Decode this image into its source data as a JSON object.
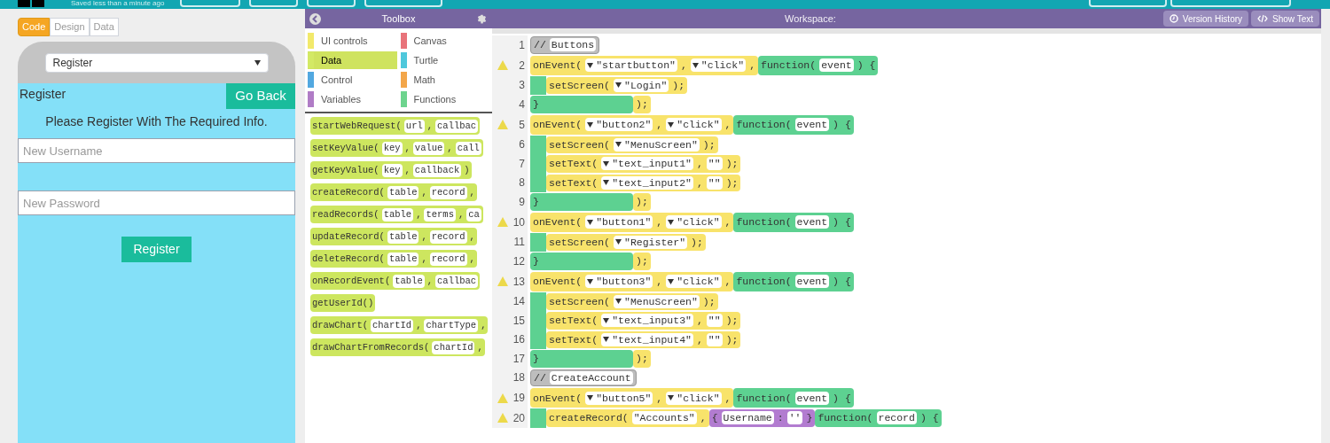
{
  "top_bar": {
    "save_status": "Saved less than a minute ago"
  },
  "mode_tabs": [
    {
      "label": "Code",
      "selected": true
    },
    {
      "label": "Design",
      "selected": false
    },
    {
      "label": "Data",
      "selected": false
    }
  ],
  "app_preview": {
    "screen_select": "Register",
    "title": "Register",
    "back_button": "Go Back",
    "heading": "Please Register With The Required Info.",
    "inputs": [
      {
        "placeholder": "New Username"
      },
      {
        "placeholder": "New Password"
      }
    ],
    "submit_button": "Register"
  },
  "toolbox": {
    "title": "Toolbox",
    "categories": [
      {
        "label": "UI controls",
        "color": "#f2e96b",
        "selected": false
      },
      {
        "label": "Canvas",
        "color": "#e8737a",
        "selected": false
      },
      {
        "label": "Data",
        "color": "#d3e965",
        "selected": true
      },
      {
        "label": "Turtle",
        "color": "#4fc8dc",
        "selected": false
      },
      {
        "label": "Control",
        "color": "#52a8e0",
        "selected": false
      },
      {
        "label": "Math",
        "color": "#f3a64a",
        "selected": false
      },
      {
        "label": "Variables",
        "color": "#b07cc6",
        "selected": false
      },
      {
        "label": "Functions",
        "color": "#6dd48e",
        "selected": false
      }
    ],
    "blocks": [
      [
        {
          "kind": "text",
          "text": "startWebRequest("
        },
        {
          "kind": "slot",
          "text": "url"
        },
        {
          "kind": "text",
          "text": ","
        },
        {
          "kind": "slot",
          "text": "callbac"
        }
      ],
      [
        {
          "kind": "text",
          "text": "setKeyValue("
        },
        {
          "kind": "slot",
          "text": "key"
        },
        {
          "kind": "text",
          "text": ","
        },
        {
          "kind": "slot",
          "text": "value"
        },
        {
          "kind": "text",
          "text": ","
        },
        {
          "kind": "slot",
          "text": "call"
        }
      ],
      [
        {
          "kind": "text",
          "text": "getKeyValue("
        },
        {
          "kind": "slot",
          "text": "key"
        },
        {
          "kind": "text",
          "text": ","
        },
        {
          "kind": "slot",
          "text": "callback"
        },
        {
          "kind": "text",
          "text": ")"
        }
      ],
      [
        {
          "kind": "text",
          "text": "createRecord("
        },
        {
          "kind": "slot",
          "text": "table"
        },
        {
          "kind": "text",
          "text": ","
        },
        {
          "kind": "slot",
          "text": "record"
        },
        {
          "kind": "text",
          "text": ","
        }
      ],
      [
        {
          "kind": "text",
          "text": "readRecords("
        },
        {
          "kind": "slot",
          "text": "table"
        },
        {
          "kind": "text",
          "text": ","
        },
        {
          "kind": "slot",
          "text": "terms"
        },
        {
          "kind": "text",
          "text": ","
        },
        {
          "kind": "slot",
          "text": "ca"
        }
      ],
      [
        {
          "kind": "text",
          "text": "updateRecord("
        },
        {
          "kind": "slot",
          "text": "table"
        },
        {
          "kind": "text",
          "text": ","
        },
        {
          "kind": "slot",
          "text": "record"
        },
        {
          "kind": "text",
          "text": ","
        }
      ],
      [
        {
          "kind": "text",
          "text": "deleteRecord("
        },
        {
          "kind": "slot",
          "text": "table"
        },
        {
          "kind": "text",
          "text": ","
        },
        {
          "kind": "slot",
          "text": "record"
        },
        {
          "kind": "text",
          "text": ","
        }
      ],
      [
        {
          "kind": "text",
          "text": "onRecordEvent("
        },
        {
          "kind": "slot",
          "text": "table"
        },
        {
          "kind": "text",
          "text": ","
        },
        {
          "kind": "slot",
          "text": "callbac"
        }
      ],
      [
        {
          "kind": "text",
          "text": "getUserId()"
        }
      ],
      [
        {
          "kind": "text",
          "text": "drawChart("
        },
        {
          "kind": "slot",
          "text": "chartId"
        },
        {
          "kind": "text",
          "text": ","
        },
        {
          "kind": "slot",
          "text": "chartType"
        },
        {
          "kind": "text",
          "text": ","
        }
      ],
      [
        {
          "kind": "text",
          "text": "drawChartFromRecords("
        },
        {
          "kind": "slot",
          "text": "chartId"
        },
        {
          "kind": "text",
          "text": ","
        }
      ]
    ]
  },
  "workspace": {
    "title": "Workspace:",
    "buttons": [
      {
        "kind": "history",
        "label": "Version History"
      },
      {
        "kind": "text",
        "label": "Show Text"
      }
    ],
    "lines": [
      {
        "number": "1",
        "warning": false,
        "indent": false,
        "parts": [
          {
            "kind": "comment",
            "tokens": [
              {
                "kind": "text",
                "text": "//"
              },
              {
                "kind": "slot",
                "text": "Buttons"
              }
            ]
          }
        ]
      },
      {
        "number": "2",
        "warning": true,
        "indent": false,
        "parts": [
          {
            "kind": "event",
            "tokens": [
              {
                "kind": "text",
                "text": "onEvent("
              },
              {
                "kind": "dropdown",
                "text": "\"startbutton\""
              },
              {
                "kind": "text",
                "text": ","
              },
              {
                "kind": "dropdown",
                "text": "\"click\""
              },
              {
                "kind": "text",
                "text": ","
              }
            ]
          },
          {
            "kind": "function",
            "tokens": [
              {
                "kind": "text",
                "text": "function("
              },
              {
                "kind": "slot",
                "text": "event"
              },
              {
                "kind": "text",
                "text": ") {"
              }
            ]
          }
        ]
      },
      {
        "number": "3",
        "warning": false,
        "indent": true,
        "parts": [
          {
            "kind": "event",
            "tokens": [
              {
                "kind": "text",
                "text": "setScreen("
              },
              {
                "kind": "dropdown",
                "text": "\"Login\""
              },
              {
                "kind": "text",
                "text": ");"
              }
            ]
          }
        ]
      },
      {
        "number": "4",
        "warning": false,
        "indent": false,
        "parts": [
          {
            "kind": "close",
            "tokens": [
              {
                "kind": "text",
                "text": "}"
              }
            ]
          },
          {
            "kind": "event",
            "tokens": [
              {
                "kind": "text",
                "text": ");"
              }
            ]
          }
        ]
      },
      {
        "number": "5",
        "warning": true,
        "indent": false,
        "parts": [
          {
            "kind": "event",
            "tokens": [
              {
                "kind": "text",
                "text": "onEvent("
              },
              {
                "kind": "dropdown",
                "text": "\"button2\""
              },
              {
                "kind": "text",
                "text": ","
              },
              {
                "kind": "dropdown",
                "text": "\"click\""
              },
              {
                "kind": "text",
                "text": ","
              }
            ]
          },
          {
            "kind": "function",
            "tokens": [
              {
                "kind": "text",
                "text": "function("
              },
              {
                "kind": "slot",
                "text": "event"
              },
              {
                "kind": "text",
                "text": ") {"
              }
            ]
          }
        ]
      },
      {
        "number": "6",
        "warning": false,
        "indent": true,
        "parts": [
          {
            "kind": "event",
            "tokens": [
              {
                "kind": "text",
                "text": "setScreen("
              },
              {
                "kind": "dropdown",
                "text": "\"MenuScreen\""
              },
              {
                "kind": "text",
                "text": ");"
              }
            ]
          }
        ]
      },
      {
        "number": "7",
        "warning": false,
        "indent": true,
        "parts": [
          {
            "kind": "event",
            "tokens": [
              {
                "kind": "text",
                "text": "setText("
              },
              {
                "kind": "dropdown",
                "text": "\"text_input1\""
              },
              {
                "kind": "text",
                "text": ","
              },
              {
                "kind": "slot",
                "text": "\"\""
              },
              {
                "kind": "text",
                "text": ");"
              }
            ]
          }
        ]
      },
      {
        "number": "8",
        "warning": false,
        "indent": true,
        "parts": [
          {
            "kind": "event",
            "tokens": [
              {
                "kind": "text",
                "text": "setText("
              },
              {
                "kind": "dropdown",
                "text": "\"text_input2\""
              },
              {
                "kind": "text",
                "text": ","
              },
              {
                "kind": "slot",
                "text": "\"\""
              },
              {
                "kind": "text",
                "text": ");"
              }
            ]
          }
        ]
      },
      {
        "number": "9",
        "warning": false,
        "indent": false,
        "parts": [
          {
            "kind": "close",
            "tokens": [
              {
                "kind": "text",
                "text": "}"
              }
            ]
          },
          {
            "kind": "event",
            "tokens": [
              {
                "kind": "text",
                "text": ");"
              }
            ]
          }
        ]
      },
      {
        "number": "10",
        "warning": true,
        "indent": false,
        "parts": [
          {
            "kind": "event",
            "tokens": [
              {
                "kind": "text",
                "text": "onEvent("
              },
              {
                "kind": "dropdown",
                "text": "\"button1\""
              },
              {
                "kind": "text",
                "text": ","
              },
              {
                "kind": "dropdown",
                "text": "\"click\""
              },
              {
                "kind": "text",
                "text": ","
              }
            ]
          },
          {
            "kind": "function",
            "tokens": [
              {
                "kind": "text",
                "text": "function("
              },
              {
                "kind": "slot",
                "text": "event"
              },
              {
                "kind": "text",
                "text": ") {"
              }
            ]
          }
        ]
      },
      {
        "number": "11",
        "warning": false,
        "indent": true,
        "parts": [
          {
            "kind": "event",
            "tokens": [
              {
                "kind": "text",
                "text": "setScreen("
              },
              {
                "kind": "dropdown",
                "text": "\"Register\""
              },
              {
                "kind": "text",
                "text": ");"
              }
            ]
          }
        ]
      },
      {
        "number": "12",
        "warning": false,
        "indent": false,
        "parts": [
          {
            "kind": "close",
            "tokens": [
              {
                "kind": "text",
                "text": "}"
              }
            ]
          },
          {
            "kind": "event",
            "tokens": [
              {
                "kind": "text",
                "text": ");"
              }
            ]
          }
        ]
      },
      {
        "number": "13",
        "warning": true,
        "indent": false,
        "parts": [
          {
            "kind": "event",
            "tokens": [
              {
                "kind": "text",
                "text": "onEvent("
              },
              {
                "kind": "dropdown",
                "text": "\"button3\""
              },
              {
                "kind": "text",
                "text": ","
              },
              {
                "kind": "dropdown",
                "text": "\"click\""
              },
              {
                "kind": "text",
                "text": ","
              }
            ]
          },
          {
            "kind": "function",
            "tokens": [
              {
                "kind": "text",
                "text": "function("
              },
              {
                "kind": "slot",
                "text": "event"
              },
              {
                "kind": "text",
                "text": ") {"
              }
            ]
          }
        ]
      },
      {
        "number": "14",
        "warning": false,
        "indent": true,
        "parts": [
          {
            "kind": "event",
            "tokens": [
              {
                "kind": "text",
                "text": "setScreen("
              },
              {
                "kind": "dropdown",
                "text": "\"MenuScreen\""
              },
              {
                "kind": "text",
                "text": ");"
              }
            ]
          }
        ]
      },
      {
        "number": "15",
        "warning": false,
        "indent": true,
        "parts": [
          {
            "kind": "event",
            "tokens": [
              {
                "kind": "text",
                "text": "setText("
              },
              {
                "kind": "dropdown",
                "text": "\"text_input3\""
              },
              {
                "kind": "text",
                "text": ","
              },
              {
                "kind": "slot",
                "text": "\"\""
              },
              {
                "kind": "text",
                "text": ");"
              }
            ]
          }
        ]
      },
      {
        "number": "16",
        "warning": false,
        "indent": true,
        "parts": [
          {
            "kind": "event",
            "tokens": [
              {
                "kind": "text",
                "text": "setText("
              },
              {
                "kind": "dropdown",
                "text": "\"text_input4\""
              },
              {
                "kind": "text",
                "text": ","
              },
              {
                "kind": "slot",
                "text": "\"\""
              },
              {
                "kind": "text",
                "text": ");"
              }
            ]
          }
        ]
      },
      {
        "number": "17",
        "warning": false,
        "indent": false,
        "parts": [
          {
            "kind": "close",
            "tokens": [
              {
                "kind": "text",
                "text": "}"
              }
            ]
          },
          {
            "kind": "event",
            "tokens": [
              {
                "kind": "text",
                "text": ");"
              }
            ]
          }
        ]
      },
      {
        "number": "18",
        "warning": false,
        "indent": false,
        "parts": [
          {
            "kind": "comment",
            "tokens": [
              {
                "kind": "text",
                "text": "//"
              },
              {
                "kind": "slot",
                "text": "CreateAccount"
              }
            ]
          }
        ]
      },
      {
        "number": "19",
        "warning": true,
        "indent": false,
        "parts": [
          {
            "kind": "event",
            "tokens": [
              {
                "kind": "text",
                "text": "onEvent("
              },
              {
                "kind": "dropdown",
                "text": "\"button5\""
              },
              {
                "kind": "text",
                "text": ","
              },
              {
                "kind": "dropdown",
                "text": "\"click\""
              },
              {
                "kind": "text",
                "text": ","
              }
            ]
          },
          {
            "kind": "function",
            "tokens": [
              {
                "kind": "text",
                "text": "function("
              },
              {
                "kind": "slot",
                "text": "event"
              },
              {
                "kind": "text",
                "text": ") {"
              }
            ]
          }
        ]
      },
      {
        "number": "20",
        "warning": true,
        "indent": true,
        "parts": [
          {
            "kind": "event",
            "tokens": [
              {
                "kind": "text",
                "text": "createRecord("
              },
              {
                "kind": "slot",
                "text": "\"Accounts\""
              },
              {
                "kind": "text",
                "text": ","
              }
            ]
          },
          {
            "kind": "object",
            "tokens": [
              {
                "kind": "text",
                "text": "{"
              },
              {
                "kind": "slot",
                "text": "Username"
              },
              {
                "kind": "text",
                "text": ":"
              },
              {
                "kind": "slot",
                "text": "''"
              },
              {
                "kind": "text",
                "text": "}"
              }
            ]
          },
          {
            "kind": "function",
            "tokens": [
              {
                "kind": "text",
                "text": "function("
              },
              {
                "kind": "slot",
                "text": "record"
              },
              {
                "kind": "text",
                "text": ") {"
              }
            ]
          }
        ]
      }
    ]
  }
}
